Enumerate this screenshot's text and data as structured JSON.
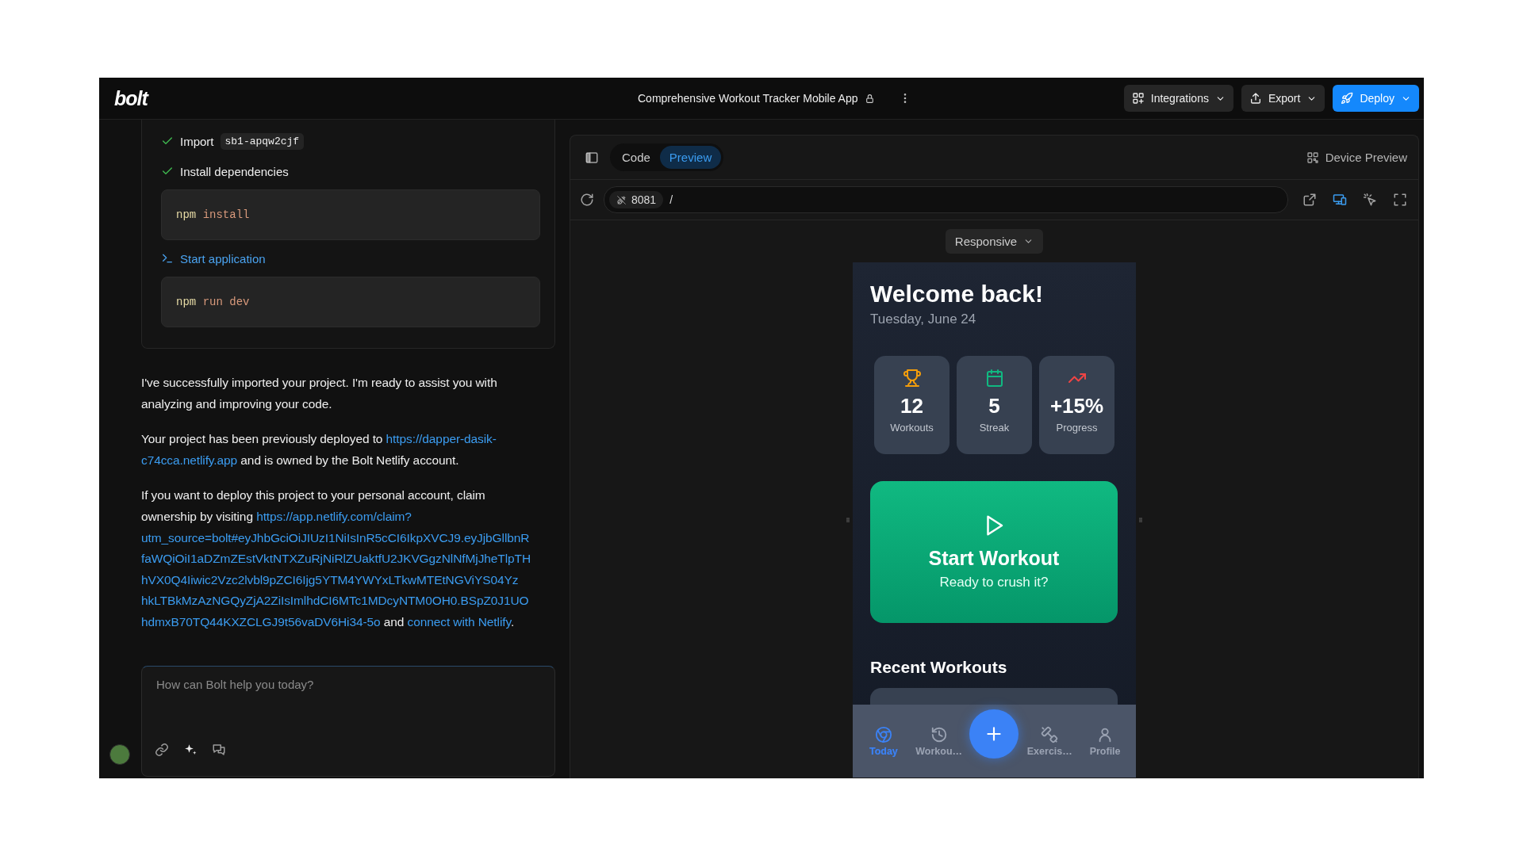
{
  "header": {
    "logo": "bolt",
    "project_title": "Comprehensive Workout Tracker Mobile App",
    "actions": [
      {
        "label": "Integrations",
        "kind": "integrations"
      },
      {
        "label": "Export",
        "kind": "export"
      },
      {
        "label": "Deploy",
        "kind": "deploy"
      }
    ]
  },
  "chat": {
    "steps": [
      {
        "kind": "done",
        "label": "Import",
        "tag": "sb1-apqw2cjf"
      },
      {
        "kind": "done",
        "label": "Install dependencies",
        "code": [
          {
            "kind": "command",
            "text": "npm"
          },
          {
            "kind": "arg",
            "text": "install"
          }
        ]
      },
      {
        "kind": "command",
        "label": "Start application",
        "code": [
          {
            "kind": "command",
            "text": "npm"
          },
          {
            "kind": "arg",
            "text": "run dev"
          }
        ]
      }
    ],
    "messages": [
      {
        "lines": [
          [
            {
              "kind": "text",
              "text": "I've successfully imported your project. I'm ready to assist you with"
            }
          ],
          [
            {
              "kind": "text",
              "text": "analyzing and improving your code."
            }
          ]
        ]
      },
      {
        "lines": [
          [
            {
              "kind": "text",
              "text": "Your project has been previously deployed to "
            },
            {
              "kind": "link",
              "text": "https://dapper-dasik-"
            }
          ],
          [
            {
              "kind": "link",
              "text": "c74cca.netlify.app"
            },
            {
              "kind": "text",
              "text": " and is owned by the Bolt Netlify account."
            }
          ]
        ]
      },
      {
        "lines": [
          [
            {
              "kind": "text",
              "text": "If you want to deploy this project to your personal account, claim"
            }
          ],
          [
            {
              "kind": "text",
              "text": "ownership by visiting "
            },
            {
              "kind": "link",
              "text": "https://app.netlify.com/claim?"
            }
          ],
          [
            {
              "kind": "link",
              "text": "utm_source=bolt#eyJhbGciOiJIUzI1NiIsInR5cCI6IkpXVCJ9.eyJjbGllbnR"
            }
          ],
          [
            {
              "kind": "link",
              "text": "faWQiOiI1aDZmZEstVktNTXZuRjNiRlZUaktfU2JKVGgzNlNfMjJheTlpTH"
            }
          ],
          [
            {
              "kind": "link",
              "text": "hVX0Q4Iiwic2Vzc2lvbl9pZCI6Ijg5YTM4YWYxLTkwMTEtNGViYS04Yz"
            }
          ],
          [
            {
              "kind": "link",
              "text": "hkLTBkMzAzNGQyZjA2ZiIsImlhdCI6MTc1MDcyNTM0OH0.BSpZ0J1UO"
            }
          ],
          [
            {
              "kind": "link",
              "text": "hdmxB70TQ44KXZCLGJ9t56vaDV6Hi34-5o"
            },
            {
              "kind": "text",
              "text": " and "
            },
            {
              "kind": "link",
              "text": "connect with Netlify"
            },
            {
              "kind": "text",
              "text": "."
            }
          ]
        ]
      }
    ],
    "input": {
      "placeholder": "How can Bolt help you today?"
    }
  },
  "preview": {
    "tabs": [
      {
        "label": "Code",
        "selected": false
      },
      {
        "label": "Preview",
        "selected": true
      }
    ],
    "device_preview": "Device Preview",
    "port": "8081",
    "path": "/",
    "view_tools": [
      {
        "kind": "open-external",
        "selected": false
      },
      {
        "kind": "devices",
        "selected": true
      },
      {
        "kind": "inspect",
        "selected": false
      },
      {
        "kind": "fullscreen",
        "selected": false
      }
    ],
    "viewport": "Responsive",
    "app": {
      "greeting": "Welcome back!",
      "date": "Tuesday, June 24",
      "stats": [
        {
          "kind": "trophy",
          "value": "12",
          "label": "Workouts",
          "color": "#f59e0b"
        },
        {
          "kind": "calendar",
          "value": "5",
          "label": "Streak",
          "color": "#10b981"
        },
        {
          "kind": "trend",
          "value": "+15%",
          "label": "Progress",
          "color": "#ef4444"
        }
      ],
      "cta": {
        "title": "Start Workout",
        "subtitle": "Ready to crush it?"
      },
      "section_title": "Recent Workouts",
      "nav": [
        {
          "kind": "today",
          "label": "Today",
          "selected": true
        },
        {
          "kind": "history",
          "label": "Workou…",
          "selected": false
        },
        {
          "kind": "add"
        },
        {
          "kind": "exercises",
          "label": "Exercis…",
          "selected": false
        },
        {
          "kind": "profile",
          "label": "Profile",
          "selected": false
        }
      ]
    }
  }
}
